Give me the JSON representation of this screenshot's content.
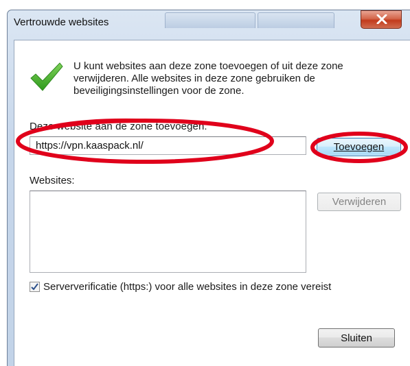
{
  "dialog": {
    "title": "Vertrouwde websites",
    "intro_text": "U kunt websites aan deze zone toevoegen of uit deze zone verwijderen. Alle websites in deze zone gebruiken de beveiligingsinstellingen voor de zone."
  },
  "add_section": {
    "label": "Deze website aan de zone toevoegen:",
    "url_value": "https://vpn.kaaspack.nl/",
    "add_button": "Toevoegen"
  },
  "websites_section": {
    "label": "Websites:",
    "items": [],
    "remove_button": "Verwijderen"
  },
  "https_check": {
    "checked": true,
    "label": "Serververificatie (https:) voor alle websites in deze zone vereist"
  },
  "footer": {
    "close_button": "Sluiten"
  },
  "colors": {
    "annotation_red": "#e0001b",
    "check_green": "#3fae2a"
  }
}
